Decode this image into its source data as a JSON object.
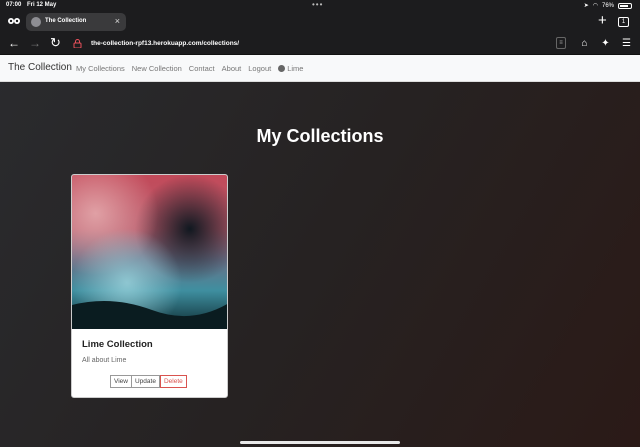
{
  "status_bar": {
    "time": "07:00",
    "date": "Fri 12 May",
    "battery": "76%"
  },
  "browser": {
    "tab_title": "The Collection",
    "tab_count": "1",
    "url": "the-collection-rpf13.herokuapp.com/collections/"
  },
  "navbar": {
    "brand": "The Collection",
    "links": [
      "My Collections",
      "New Collection",
      "Contact",
      "About",
      "Logout"
    ],
    "user": "Lime"
  },
  "main": {
    "heading": "My Collections",
    "card": {
      "title": "Lime Collection",
      "description": "All about Lime",
      "view_label": "View",
      "update_label": "Update",
      "delete_label": "Delete"
    }
  },
  "colors": {
    "delete": "#d9534f",
    "navbar_bg": "#f8f9fa"
  }
}
